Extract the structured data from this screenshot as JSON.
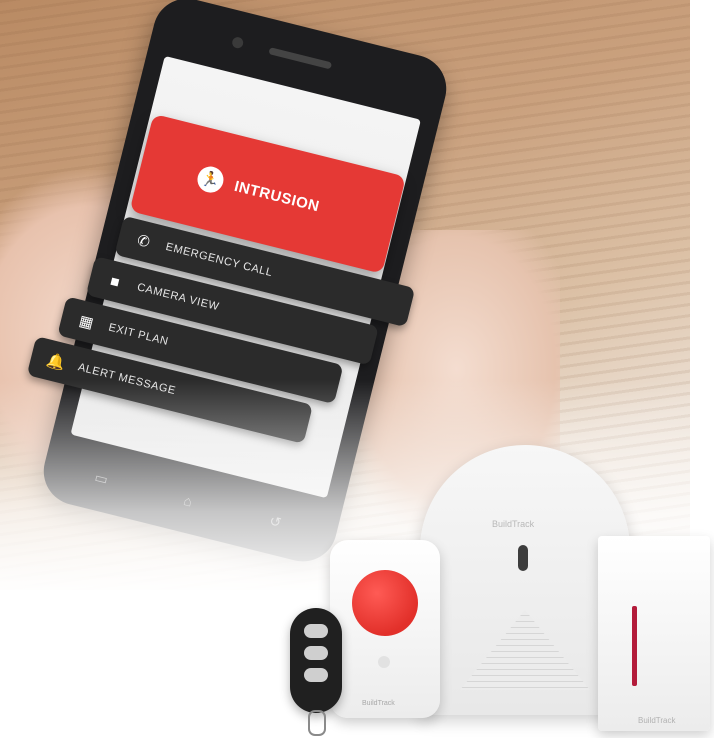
{
  "alert": {
    "label": "INTRUSION",
    "icon": "running-person-icon",
    "color": "#e53935"
  },
  "menu": {
    "items": [
      {
        "label": "EMERGENCY CALL",
        "icon": "phone-icon"
      },
      {
        "label": "CAMERA VIEW",
        "icon": "video-camera-icon"
      },
      {
        "label": "EXIT PLAN",
        "icon": "map-icon"
      },
      {
        "label": "ALERT MESSAGE",
        "icon": "bell-icon"
      }
    ]
  },
  "devices": {
    "brand": "BuildTrack"
  }
}
